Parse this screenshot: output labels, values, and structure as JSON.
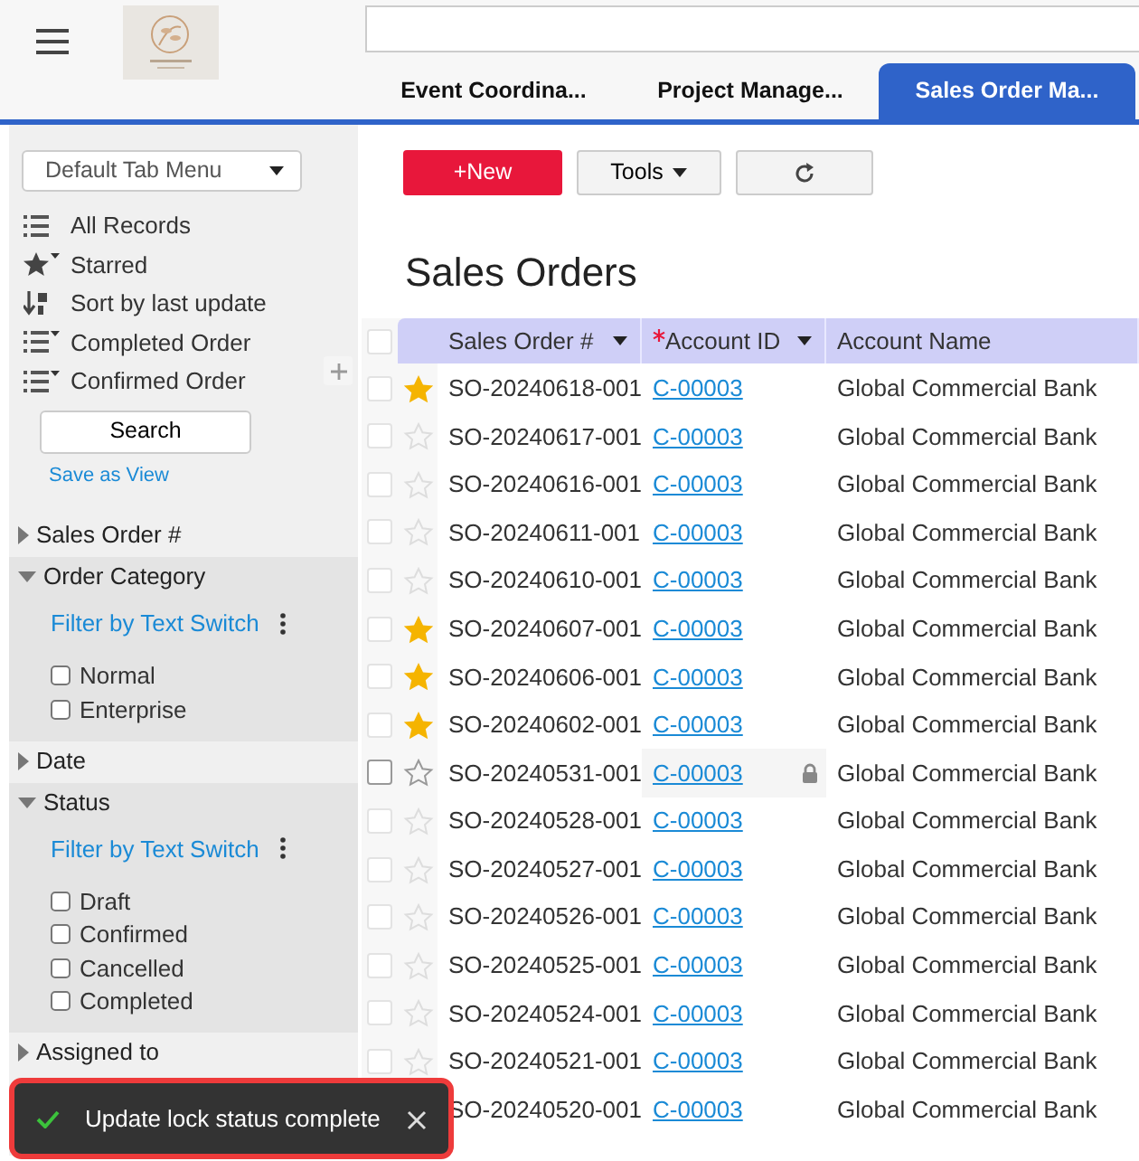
{
  "header": {
    "tabs": [
      {
        "label": "Event Coordina...",
        "selected": false
      },
      {
        "label": "Project Manage...",
        "selected": false
      },
      {
        "label": "Sales Order Ma...",
        "selected": true
      }
    ]
  },
  "sidebar": {
    "view_menu": "Default Tab Menu",
    "views": [
      {
        "label": "All Records",
        "kind": "list"
      },
      {
        "label": "Starred",
        "kind": "star"
      },
      {
        "label": "Sort by last update",
        "kind": "sort"
      },
      {
        "label": "Completed Order",
        "kind": "filter"
      },
      {
        "label": "Confirmed Order",
        "kind": "filter"
      }
    ],
    "search_button": "Search",
    "save_link": "Save as View",
    "filters": [
      {
        "label": "Sales Order #",
        "expanded": false
      },
      {
        "label": "Order Category",
        "expanded": true,
        "filter_link": "Filter by Text Switch",
        "options": [
          {
            "label": "Normal",
            "checked": false
          },
          {
            "label": "Enterprise",
            "checked": false
          }
        ]
      },
      {
        "label": "Date",
        "expanded": false
      },
      {
        "label": "Status",
        "expanded": true,
        "filter_link": "Filter by Text Switch",
        "options": [
          {
            "label": "Draft",
            "checked": false
          },
          {
            "label": "Confirmed",
            "checked": false
          },
          {
            "label": "Cancelled",
            "checked": false
          },
          {
            "label": "Completed",
            "checked": false
          }
        ]
      },
      {
        "label": "Assigned to",
        "expanded": false
      }
    ]
  },
  "toolbar": {
    "new_button": "+New",
    "tools_button": "Tools"
  },
  "title": "Sales Orders",
  "table": {
    "all_selected": false,
    "columns": [
      {
        "label": "Sales Order #",
        "required": false,
        "sortable": true
      },
      {
        "label": "Account ID",
        "required": true,
        "sortable": true
      },
      {
        "label": "Account Name",
        "required": false,
        "sortable": false
      }
    ],
    "rows": [
      {
        "order": "SO-20240618-001",
        "account_id": "C-00003",
        "account_name": "Global Commercial Bank",
        "selected": false,
        "starred": true,
        "locked": false
      },
      {
        "order": "SO-20240617-001",
        "account_id": "C-00003",
        "account_name": "Global Commercial Bank",
        "selected": false,
        "starred": false,
        "locked": false
      },
      {
        "order": "SO-20240616-001",
        "account_id": "C-00003",
        "account_name": "Global Commercial Bank",
        "selected": false,
        "starred": false,
        "locked": false
      },
      {
        "order": "SO-20240611-001",
        "account_id": "C-00003",
        "account_name": "Global Commercial Bank",
        "selected": false,
        "starred": false,
        "locked": false
      },
      {
        "order": "SO-20240610-001",
        "account_id": "C-00003",
        "account_name": "Global Commercial Bank",
        "selected": false,
        "starred": false,
        "locked": false
      },
      {
        "order": "SO-20240607-001",
        "account_id": "C-00003",
        "account_name": "Global Commercial Bank",
        "selected": false,
        "starred": true,
        "locked": false
      },
      {
        "order": "SO-20240606-001",
        "account_id": "C-00003",
        "account_name": "Global Commercial Bank",
        "selected": false,
        "starred": true,
        "locked": false
      },
      {
        "order": "SO-20240602-001",
        "account_id": "C-00003",
        "account_name": "Global Commercial Bank",
        "selected": false,
        "starred": true,
        "locked": false
      },
      {
        "order": "SO-20240531-001",
        "account_id": "C-00003",
        "account_name": "Global Commercial Bank",
        "selected": false,
        "starred": false,
        "locked": true
      },
      {
        "order": "SO-20240528-001",
        "account_id": "C-00003",
        "account_name": "Global Commercial Bank",
        "selected": false,
        "starred": false,
        "locked": false
      },
      {
        "order": "SO-20240527-001",
        "account_id": "C-00003",
        "account_name": "Global Commercial Bank",
        "selected": false,
        "starred": false,
        "locked": false
      },
      {
        "order": "SO-20240526-001",
        "account_id": "C-00003",
        "account_name": "Global Commercial Bank",
        "selected": false,
        "starred": false,
        "locked": false
      },
      {
        "order": "SO-20240525-001",
        "account_id": "C-00003",
        "account_name": "Global Commercial Bank",
        "selected": false,
        "starred": false,
        "locked": false
      },
      {
        "order": "SO-20240524-001",
        "account_id": "C-00003",
        "account_name": "Global Commercial Bank",
        "selected": false,
        "starred": false,
        "locked": false
      },
      {
        "order": "SO-20240521-001",
        "account_id": "C-00003",
        "account_name": "Global Commercial Bank",
        "selected": false,
        "starred": false,
        "locked": false
      },
      {
        "order": "SO-20240520-001",
        "account_id": "C-00003",
        "account_name": "Global Commercial Bank",
        "locked": false
      }
    ]
  },
  "toast": {
    "message": "Update lock status complete"
  }
}
